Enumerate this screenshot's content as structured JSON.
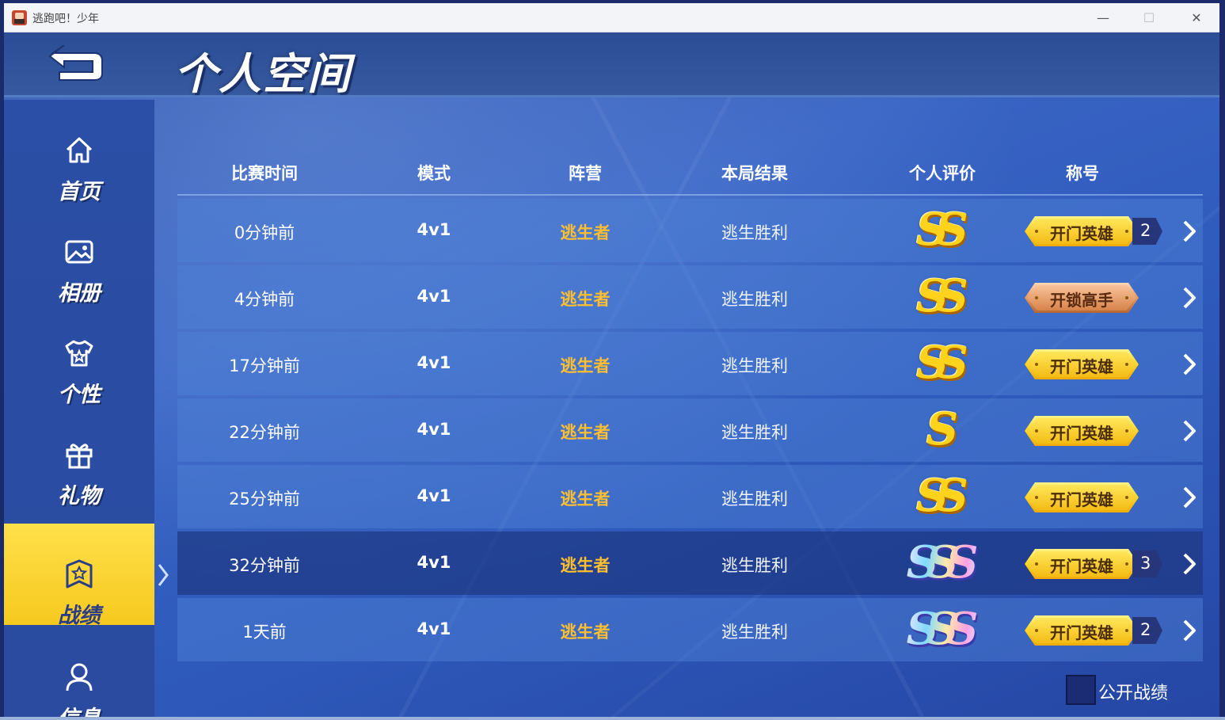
{
  "window": {
    "title": "逃跑吧！少年",
    "minimize": "—",
    "maximize": "☐",
    "close": "✕"
  },
  "header": {
    "title": "个人空间"
  },
  "sidebar": {
    "items": [
      {
        "label": "首页",
        "icon": "home-icon"
      },
      {
        "label": "相册",
        "icon": "image-icon"
      },
      {
        "label": "个性",
        "icon": "shirt-icon"
      },
      {
        "label": "礼物",
        "icon": "gift-icon"
      },
      {
        "label": "战绩",
        "icon": "badge-icon",
        "active": true
      },
      {
        "label": "信息",
        "icon": "user-icon"
      }
    ],
    "active_color": "#f6c91e"
  },
  "table": {
    "columns": [
      "比赛时间",
      "模式",
      "阵营",
      "本局结果",
      "个人评价",
      "称号"
    ],
    "rows": [
      {
        "time": "0分钟前",
        "mode": "4v1",
        "camp": "逃生者",
        "result": "逃生胜利",
        "grade": "SS",
        "grade_style": "gold",
        "title": "开门英雄",
        "title_style": "gold",
        "count": "2"
      },
      {
        "time": "4分钟前",
        "mode": "4v1",
        "camp": "逃生者",
        "result": "逃生胜利",
        "grade": "SS",
        "grade_style": "gold",
        "title": "开锁高手",
        "title_style": "copper",
        "count": ""
      },
      {
        "time": "17分钟前",
        "mode": "4v1",
        "camp": "逃生者",
        "result": "逃生胜利",
        "grade": "SS",
        "grade_style": "gold",
        "title": "开门英雄",
        "title_style": "gold",
        "count": ""
      },
      {
        "time": "22分钟前",
        "mode": "4v1",
        "camp": "逃生者",
        "result": "逃生胜利",
        "grade": "S",
        "grade_style": "gold",
        "title": "开门英雄",
        "title_style": "gold",
        "count": ""
      },
      {
        "time": "25分钟前",
        "mode": "4v1",
        "camp": "逃生者",
        "result": "逃生胜利",
        "grade": "SS",
        "grade_style": "gold",
        "title": "开门英雄",
        "title_style": "gold",
        "count": ""
      },
      {
        "time": "32分钟前",
        "mode": "4v1",
        "camp": "逃生者",
        "result": "逃生胜利",
        "grade": "SSS",
        "grade_style": "rainbow",
        "title": "开门英雄",
        "title_style": "gold",
        "count": "3",
        "highlight": true
      },
      {
        "time": "1天前",
        "mode": "4v1",
        "camp": "逃生者",
        "result": "逃生胜利",
        "grade": "SSS",
        "grade_style": "rainbow",
        "title": "开门英雄",
        "title_style": "gold",
        "count": "2"
      }
    ],
    "camp_color": "#ffbf2f"
  },
  "footer": {
    "public_record_label": "公开战绩",
    "public_record_checked": false
  }
}
